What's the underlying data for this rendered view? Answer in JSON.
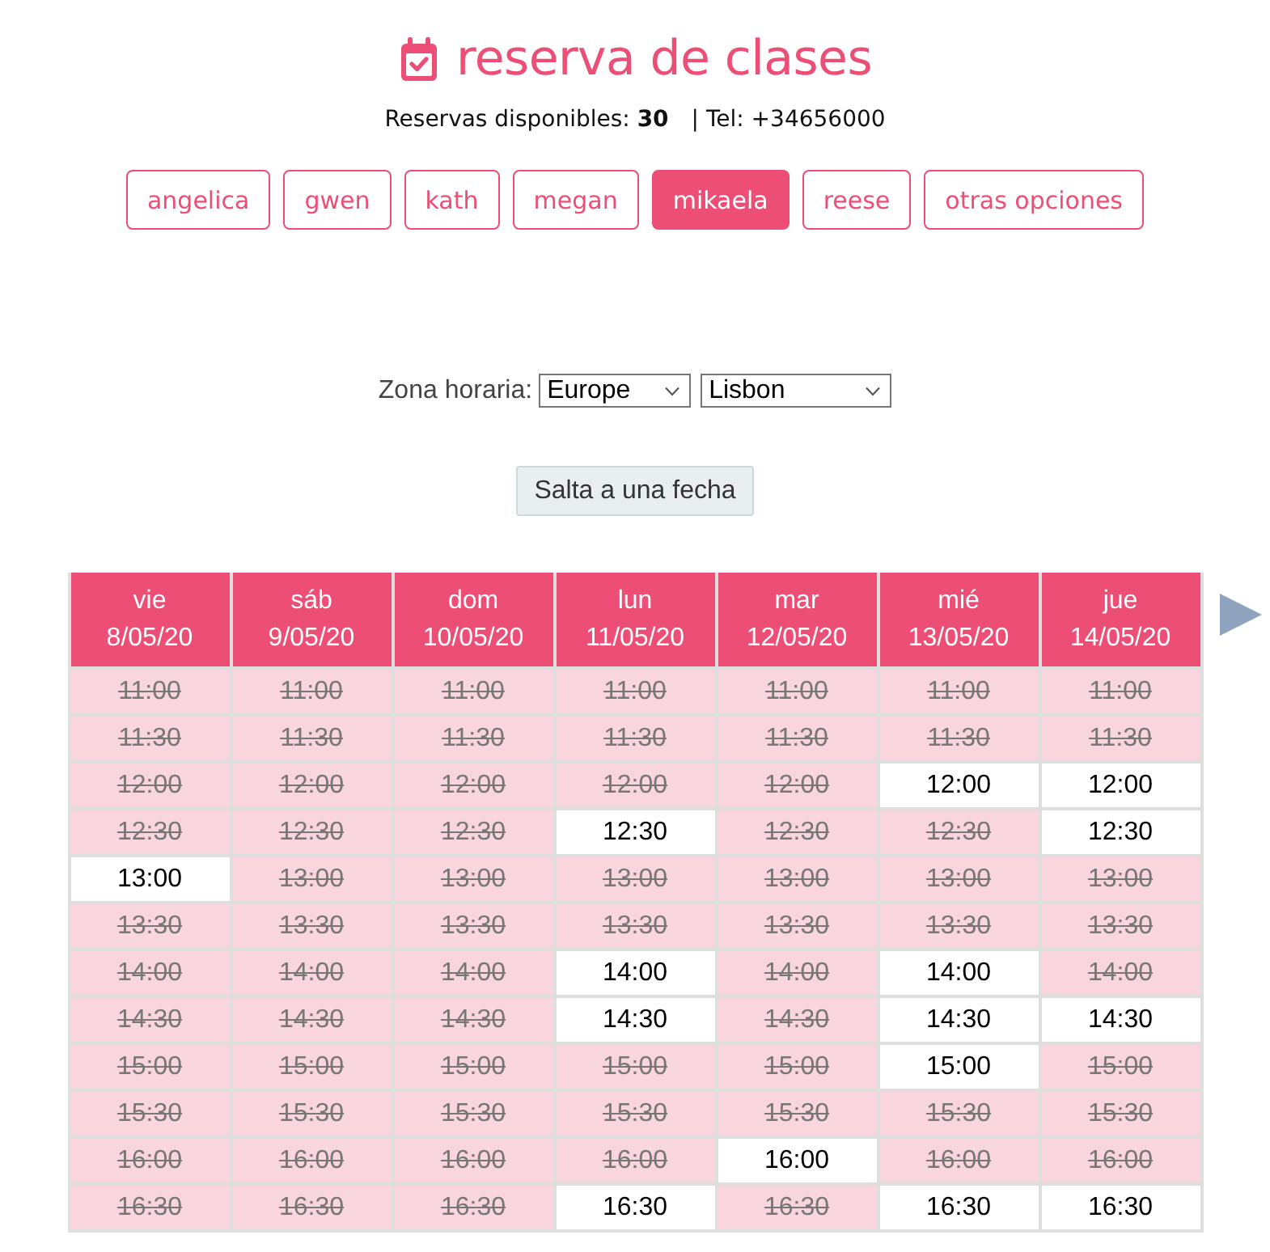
{
  "header": {
    "title": "reserva de clases",
    "bookings_available": "Reservas disponibles: **30**",
    "phone": "| Tel: +34656000"
  },
  "teachers": [
    {
      "label": "angelica",
      "selected": false
    },
    {
      "label": "gwen",
      "selected": false
    },
    {
      "label": "kath",
      "selected": false
    },
    {
      "label": "megan",
      "selected": false
    },
    {
      "label": "mikaela",
      "selected": true
    },
    {
      "label": "reese",
      "selected": false
    },
    {
      "label": "otras opciones",
      "selected": false
    }
  ],
  "timezone": {
    "label": "Zona horaria:",
    "region": "Europe",
    "city": "Lisbon"
  },
  "jump_button": "Salta a una fecha",
  "schedule": {
    "days": [
      {
        "day": "vie",
        "date": "8/05/20",
        "slots": [
          {
            "time": "11:00",
            "available": false
          },
          {
            "time": "11:30",
            "available": false
          },
          {
            "time": "12:00",
            "available": false
          },
          {
            "time": "12:30",
            "available": false
          },
          {
            "time": "13:00",
            "available": true
          },
          {
            "time": "13:30",
            "available": false
          },
          {
            "time": "14:00",
            "available": false
          },
          {
            "time": "14:30",
            "available": false
          },
          {
            "time": "15:00",
            "available": false
          },
          {
            "time": "15:30",
            "available": false
          },
          {
            "time": "16:00",
            "available": false
          },
          {
            "time": "16:30",
            "available": false
          }
        ]
      },
      {
        "day": "sáb",
        "date": "9/05/20",
        "slots": [
          {
            "time": "11:00",
            "available": false
          },
          {
            "time": "11:30",
            "available": false
          },
          {
            "time": "12:00",
            "available": false
          },
          {
            "time": "12:30",
            "available": false
          },
          {
            "time": "13:00",
            "available": false
          },
          {
            "time": "13:30",
            "available": false
          },
          {
            "time": "14:00",
            "available": false
          },
          {
            "time": "14:30",
            "available": false
          },
          {
            "time": "15:00",
            "available": false
          },
          {
            "time": "15:30",
            "available": false
          },
          {
            "time": "16:00",
            "available": false
          },
          {
            "time": "16:30",
            "available": false
          }
        ]
      },
      {
        "day": "dom",
        "date": "10/05/20",
        "slots": [
          {
            "time": "11:00",
            "available": false
          },
          {
            "time": "11:30",
            "available": false
          },
          {
            "time": "12:00",
            "available": false
          },
          {
            "time": "12:30",
            "available": false
          },
          {
            "time": "13:00",
            "available": false
          },
          {
            "time": "13:30",
            "available": false
          },
          {
            "time": "14:00",
            "available": false
          },
          {
            "time": "14:30",
            "available": false
          },
          {
            "time": "15:00",
            "available": false
          },
          {
            "time": "15:30",
            "available": false
          },
          {
            "time": "16:00",
            "available": false
          },
          {
            "time": "16:30",
            "available": false
          }
        ]
      },
      {
        "day": "lun",
        "date": "11/05/20",
        "slots": [
          {
            "time": "11:00",
            "available": false
          },
          {
            "time": "11:30",
            "available": false
          },
          {
            "time": "12:00",
            "available": false
          },
          {
            "time": "12:30",
            "available": true
          },
          {
            "time": "13:00",
            "available": false
          },
          {
            "time": "13:30",
            "available": false
          },
          {
            "time": "14:00",
            "available": true
          },
          {
            "time": "14:30",
            "available": true
          },
          {
            "time": "15:00",
            "available": false
          },
          {
            "time": "15:30",
            "available": false
          },
          {
            "time": "16:00",
            "available": false
          },
          {
            "time": "16:30",
            "available": true
          }
        ]
      },
      {
        "day": "mar",
        "date": "12/05/20",
        "slots": [
          {
            "time": "11:00",
            "available": false
          },
          {
            "time": "11:30",
            "available": false
          },
          {
            "time": "12:00",
            "available": false
          },
          {
            "time": "12:30",
            "available": false
          },
          {
            "time": "13:00",
            "available": false
          },
          {
            "time": "13:30",
            "available": false
          },
          {
            "time": "14:00",
            "available": false
          },
          {
            "time": "14:30",
            "available": false
          },
          {
            "time": "15:00",
            "available": false
          },
          {
            "time": "15:30",
            "available": false
          },
          {
            "time": "16:00",
            "available": true
          },
          {
            "time": "16:30",
            "available": false
          }
        ]
      },
      {
        "day": "mié",
        "date": "13/05/20",
        "slots": [
          {
            "time": "11:00",
            "available": false
          },
          {
            "time": "11:30",
            "available": false
          },
          {
            "time": "12:00",
            "available": true
          },
          {
            "time": "12:30",
            "available": false
          },
          {
            "time": "13:00",
            "available": false
          },
          {
            "time": "13:30",
            "available": false
          },
          {
            "time": "14:00",
            "available": true
          },
          {
            "time": "14:30",
            "available": true
          },
          {
            "time": "15:00",
            "available": true
          },
          {
            "time": "15:30",
            "available": false
          },
          {
            "time": "16:00",
            "available": false
          },
          {
            "time": "16:30",
            "available": true
          }
        ]
      },
      {
        "day": "jue",
        "date": "14/05/20",
        "slots": [
          {
            "time": "11:00",
            "available": false
          },
          {
            "time": "11:30",
            "available": false
          },
          {
            "time": "12:00",
            "available": true
          },
          {
            "time": "12:30",
            "available": true
          },
          {
            "time": "13:00",
            "available": false
          },
          {
            "time": "13:30",
            "available": false
          },
          {
            "time": "14:00",
            "available": false
          },
          {
            "time": "14:30",
            "available": true
          },
          {
            "time": "15:00",
            "available": false
          },
          {
            "time": "15:30",
            "available": false
          },
          {
            "time": "16:00",
            "available": false
          },
          {
            "time": "16:30",
            "available": true
          }
        ]
      }
    ]
  }
}
